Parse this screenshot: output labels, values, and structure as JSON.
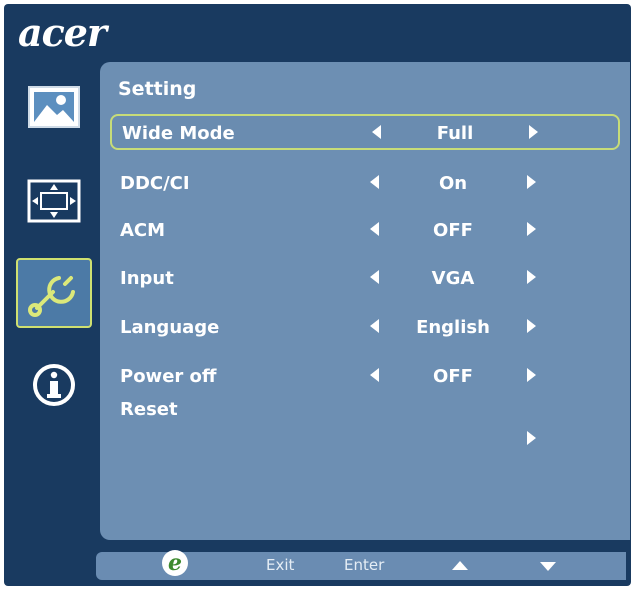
{
  "brand": "acer",
  "sidebar": [
    {
      "icon": "picture-icon"
    },
    {
      "icon": "position-icon"
    },
    {
      "icon": "settings-wrench-icon"
    },
    {
      "icon": "info-icon"
    }
  ],
  "panel": {
    "title": "Setting",
    "rows": [
      {
        "label": "Wide Mode",
        "value": "Full",
        "selected": true
      },
      {
        "label": "DDC/CI",
        "value": "On"
      },
      {
        "label": "ACM",
        "value": "OFF"
      },
      {
        "label": "Input",
        "value": "VGA"
      },
      {
        "label": "Language",
        "value": "English"
      },
      {
        "label": "Power off",
        "value": "OFF"
      }
    ],
    "reset_label": "Reset"
  },
  "footer": {
    "exit_label": "Exit",
    "enter_label": "Enter",
    "e_glyph": "e"
  },
  "colors": {
    "frame": "#193a60",
    "panel": "#6d8fb3",
    "highlight": "#c7dc78"
  }
}
